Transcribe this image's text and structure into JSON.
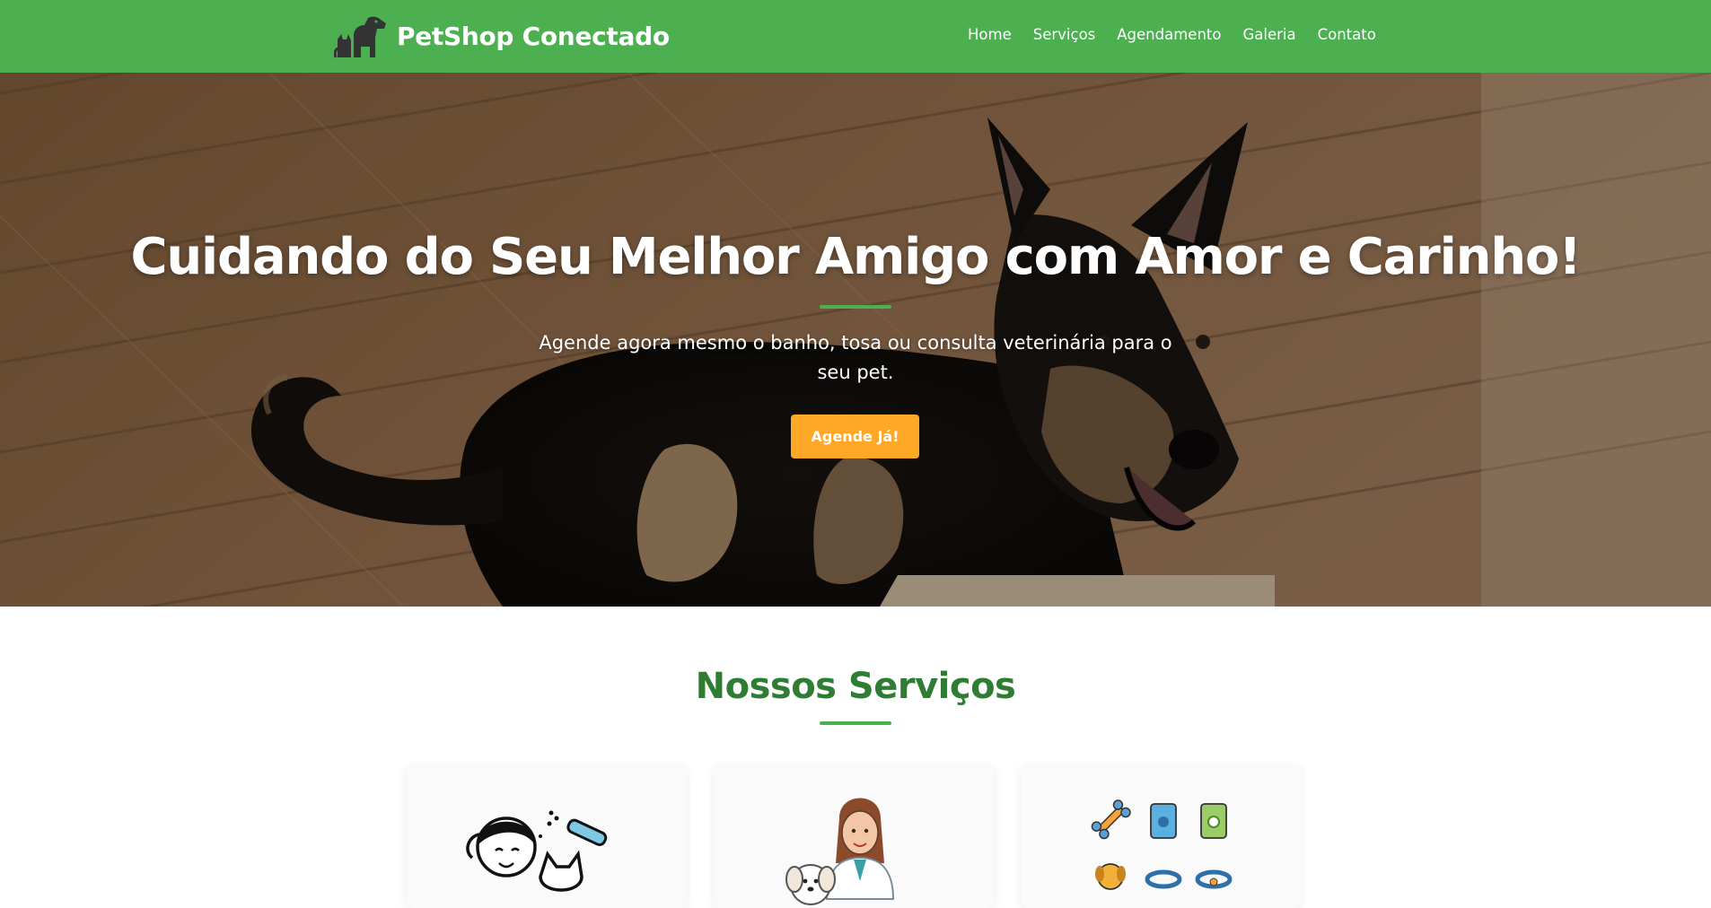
{
  "brand": {
    "name": "PetShop Conectado",
    "logo": "dog-cat-silhouette-logo"
  },
  "nav": {
    "items": [
      "Home",
      "Serviços",
      "Agendamento",
      "Galeria",
      "Contato"
    ]
  },
  "hero": {
    "title": "Cuidando do Seu Melhor Amigo com Amor e Carinho!",
    "subtitle": "Agende agora mesmo o banho, tosa ou consulta veterinária para o seu pet.",
    "cta_label": "Agende Já!",
    "background_image": "german-shepherd-on-wood-floor"
  },
  "services": {
    "title": "Nossos Serviços",
    "cards": [
      {
        "image": "groomer-brushing-cat-illustration"
      },
      {
        "image": "veterinarian-with-puppy-illustration"
      },
      {
        "image": "pet-products-icons-illustration"
      }
    ]
  },
  "colors": {
    "header_bg": "#4caf50",
    "accent_orange": "#ffa726",
    "title_green": "#2e7d32"
  }
}
